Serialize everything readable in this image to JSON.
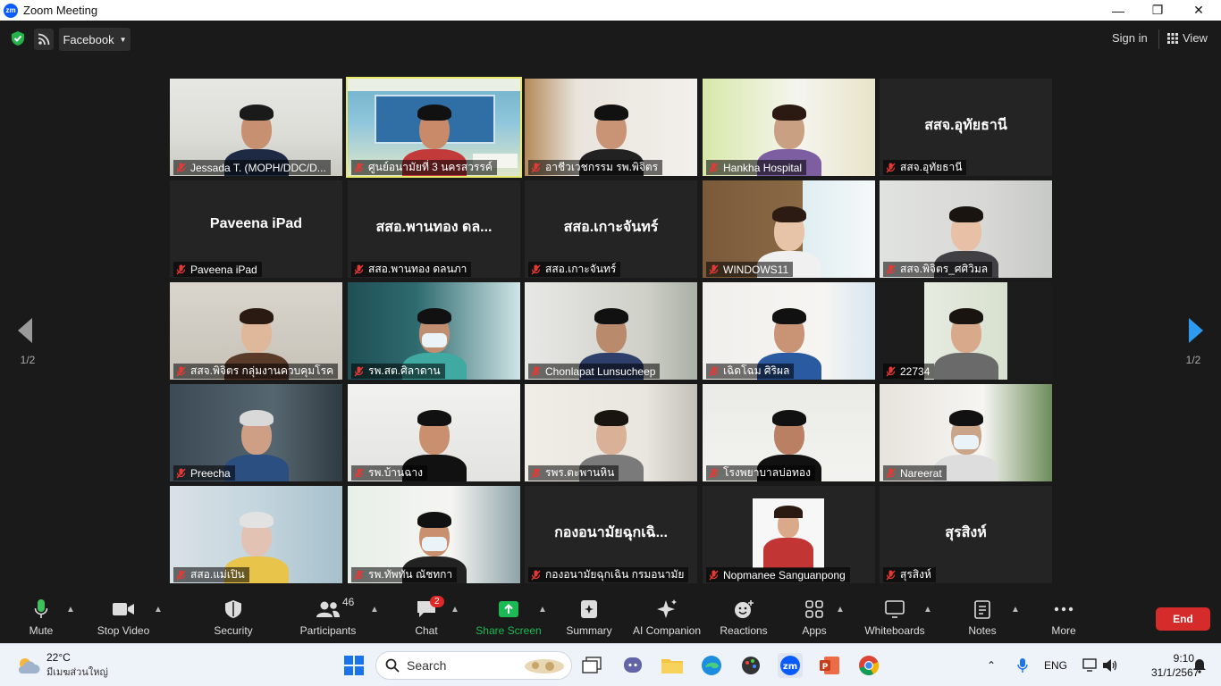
{
  "window": {
    "title": "Zoom Meeting",
    "minimize": "—",
    "maximize": "❐",
    "close": "✕"
  },
  "topbar": {
    "stream_label": "Facebook",
    "signin": "Sign in",
    "view": "View"
  },
  "pager": {
    "left_text": "1/2",
    "right_text": "1/2"
  },
  "participants": [
    {
      "label": "Jessada T. (MOPH/DDC/D...",
      "big": "",
      "active": false
    },
    {
      "label": "ศูนย์อนามัยที่ 3 นครสวรรค์",
      "big": "",
      "active": true
    },
    {
      "label": "อาชีวเวชกรรม รพ.พิจิตร",
      "big": "",
      "active": false
    },
    {
      "label": "Hankha Hospital",
      "big": "",
      "active": false
    },
    {
      "label": "สสจ.อุทัยธานี",
      "big": "สสจ.อุทัยธานี",
      "active": false
    },
    {
      "label": "Paveena iPad",
      "big": "Paveena iPad",
      "active": false
    },
    {
      "label": "สสอ.พานทอง ดลนภา",
      "big": "สสอ.พานทอง ดล...",
      "active": false
    },
    {
      "label": "สสอ.เกาะจันทร์",
      "big": "สสอ.เกาะจันทร์",
      "active": false
    },
    {
      "label": "WINDOWS11",
      "big": "",
      "active": false
    },
    {
      "label": "สสจ.พิจิตร_ศศิวิมล",
      "big": "",
      "active": false
    },
    {
      "label": "สสจ.พิจิตร กลุ่มงานควบคุมโรค",
      "big": "",
      "active": false
    },
    {
      "label": "รพ.สต.ศิลาดาน",
      "big": "",
      "active": false
    },
    {
      "label": "Chonlapat Lunsucheep",
      "big": "",
      "active": false
    },
    {
      "label": "เฉิดโฉม ศิริผล",
      "big": "",
      "active": false
    },
    {
      "label": "22734",
      "big": "",
      "active": false
    },
    {
      "label": "Preecha",
      "big": "",
      "active": false
    },
    {
      "label": "รพ.บ้านฉาง",
      "big": "",
      "active": false
    },
    {
      "label": "รพร.ตะพานหิน",
      "big": "",
      "active": false
    },
    {
      "label": "โรงพยาบาลบ่อทอง",
      "big": "",
      "active": false
    },
    {
      "label": "Nareerat",
      "big": "",
      "active": false
    },
    {
      "label": "สสอ.แม่เปิน",
      "big": "",
      "active": false
    },
    {
      "label": "รพ.ทัพทัน ณัชทกา",
      "big": "",
      "active": false
    },
    {
      "label": "กองอนามัยฉุกเฉิน กรมอนามัย",
      "big": "กองอนามัยฉุกเฉิ...",
      "active": false
    },
    {
      "label": "Nopmanee Sanguanpong",
      "big": "",
      "active": false
    },
    {
      "label": "สุรสิงห์",
      "big": "สุรสิงห์",
      "active": false
    }
  ],
  "toolbar": {
    "mute": "Mute",
    "stop_video": "Stop Video",
    "security": "Security",
    "participants": "Participants",
    "participants_count": "46",
    "chat": "Chat",
    "chat_badge": "2",
    "share_screen": "Share Screen",
    "summary": "Summary",
    "ai_companion": "AI Companion",
    "reactions": "Reactions",
    "apps": "Apps",
    "whiteboards": "Whiteboards",
    "notes": "Notes",
    "more": "More",
    "end": "End"
  },
  "colors": {
    "share_green": "#1db954",
    "end_red": "#d52b2b",
    "active_border": "#e8e86a",
    "zoom_blue": "#0b5cff"
  },
  "taskbar": {
    "temp": "22°C",
    "weather_desc": "มีเมฆส่วนใหญ่",
    "search": "Search",
    "lang": "ENG",
    "time": "9:10",
    "date": "31/1/2567"
  }
}
